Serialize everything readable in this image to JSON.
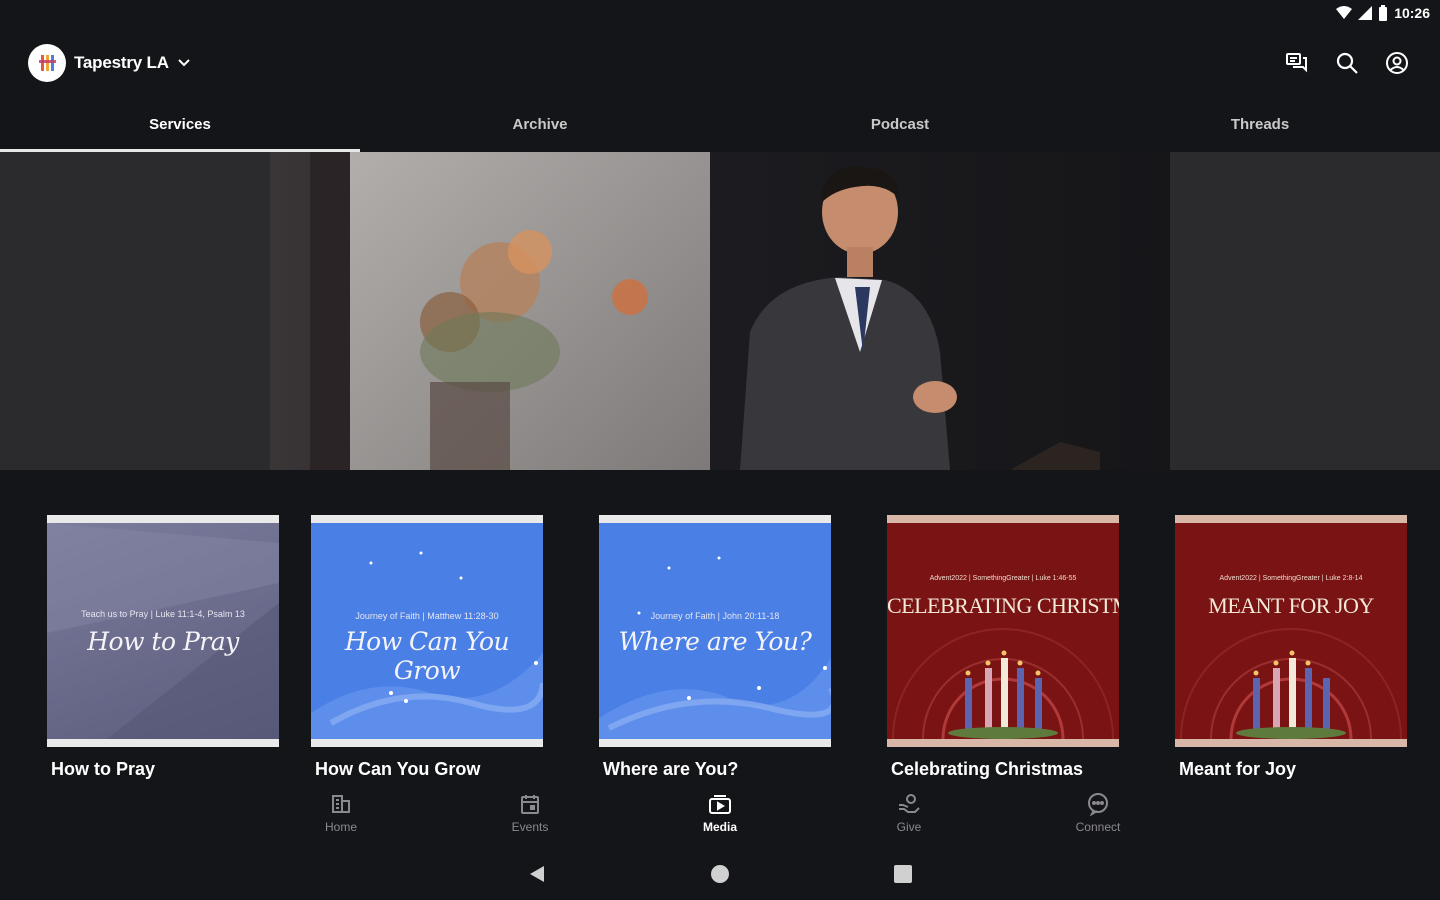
{
  "status": {
    "time": "10:26"
  },
  "org": {
    "name": "Tapestry LA"
  },
  "tabs": [
    {
      "label": "Services"
    },
    {
      "label": "Archive"
    },
    {
      "label": "Podcast"
    },
    {
      "label": "Threads"
    }
  ],
  "cards": [
    {
      "title": "How to Pray",
      "thumb_small": "Teach us to Pray | Luke 11:1-4, Psalm 13",
      "thumb_text": "How to Pray"
    },
    {
      "title": "How Can You Grow",
      "thumb_small": "Journey of Faith | Matthew 11:28-30",
      "thumb_text": "How Can You Grow"
    },
    {
      "title": "Where are You?",
      "thumb_small": "Journey of Faith | John 20:11-18",
      "thumb_text": "Where are You?"
    },
    {
      "title": "Celebrating Christmas",
      "thumb_small": "Advent2022 | SomethingGreater | Luke 1:46-55",
      "thumb_text": "CELEBRATING CHRISTMAS"
    },
    {
      "title": "Meant for Joy",
      "thumb_small": "Advent2022 | SomethingGreater | Luke 2:8-14",
      "thumb_text": "MEANT FOR JOY"
    }
  ],
  "bottom_nav": [
    {
      "label": "Home",
      "icon": "home-icon"
    },
    {
      "label": "Events",
      "icon": "calendar-icon"
    },
    {
      "label": "Media",
      "icon": "media-icon"
    },
    {
      "label": "Give",
      "icon": "give-icon"
    },
    {
      "label": "Connect",
      "icon": "chat-icon"
    }
  ],
  "colors": {
    "background": "#141518",
    "blue_thumb": "#4a7fe6",
    "red_thumb": "#7a1313",
    "purple_thumb": "#6a6a8e"
  }
}
